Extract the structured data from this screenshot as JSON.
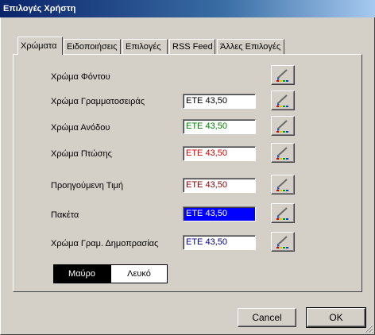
{
  "window": {
    "title": "Επιλογές Χρήστη"
  },
  "tabs": [
    {
      "label": "Χρώματα"
    },
    {
      "label": "Ειδοποιήσεις"
    },
    {
      "label": "Επιλογές"
    },
    {
      "label": "RSS Feed"
    },
    {
      "label": "Άλλες Επιλογές"
    }
  ],
  "rows": [
    {
      "label": "Χρώμα Φόντου",
      "value": "",
      "text_color": "#000000",
      "bg_color": "#ffffff",
      "icon": "palette-brush-icon"
    },
    {
      "label": "Χρώμα Γραμματοσειράς",
      "value": "ΕΤΕ 43,50",
      "text_color": "#000000",
      "bg_color": "#ffffff",
      "icon": "palette-brush-icon"
    },
    {
      "label": "Χρώμα Ανόδου",
      "value": "ΕΤΕ 43,50",
      "text_color": "#008000",
      "bg_color": "#ffffff",
      "icon": "palette-brush-icon"
    },
    {
      "label": "Χρώμα Πτώσης",
      "value": "ΕΤΕ 43,50",
      "text_color": "#cc0000",
      "bg_color": "#ffffff",
      "icon": "palette-brush-icon"
    },
    {
      "label": "Προηγούμενη Τιμή",
      "value": "ΕΤΕ 43,50",
      "text_color": "#800000",
      "bg_color": "#ffffff",
      "icon": "palette-brush-icon"
    },
    {
      "label": "Πακέτα",
      "value": "ΕΤΕ 43,50",
      "text_color": "#ffffff",
      "bg_color": "#0000ff",
      "icon": "palette-brush-icon"
    },
    {
      "label": "Χρώμα Γραμ. Δημοπρασίας",
      "value": "ΕΤΕ 43,50",
      "text_color": "#000080",
      "bg_color": "#ffffff",
      "icon": "palette-brush-icon"
    }
  ],
  "theme_toggle": {
    "options": [
      "Μαύρο",
      "Λευκό"
    ],
    "selected": "Μαύρο"
  },
  "buttons": {
    "cancel": "Cancel",
    "ok": "OK"
  },
  "colors": {
    "titlebar_start": "#0a246a",
    "titlebar_end": "#a6caf0",
    "dialog_bg": "#d4d0c8"
  }
}
